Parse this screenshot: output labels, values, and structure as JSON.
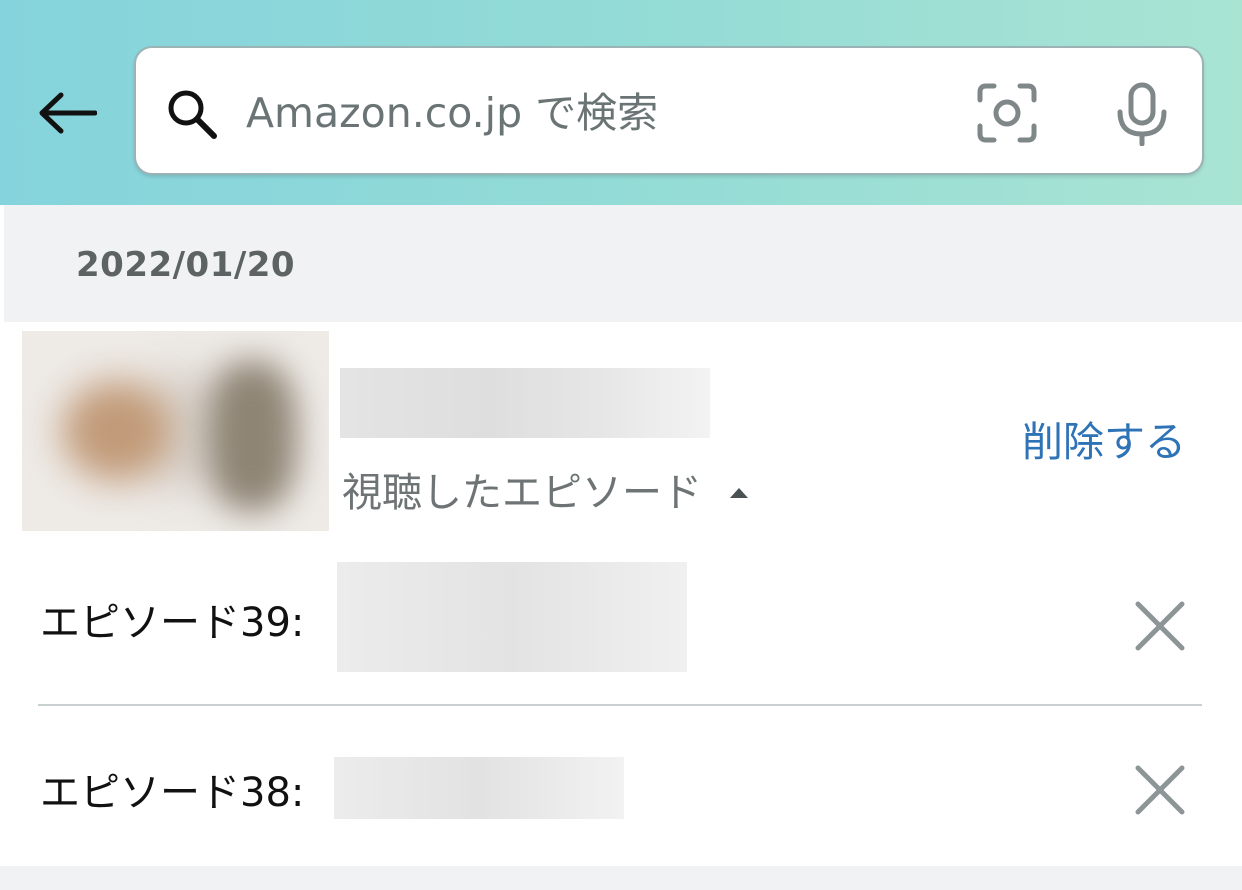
{
  "header": {
    "search": {
      "placeholder": "Amazon.co.jp で検索",
      "value": ""
    },
    "icons": [
      "back-arrow-icon",
      "search-icon",
      "camera-icon",
      "microphone-icon"
    ],
    "gradient_colors": [
      "#85d3dc",
      "#a9e4d3"
    ]
  },
  "history": {
    "date": "2022/01/20",
    "item": {
      "delete_label": "削除する",
      "watched_label": "視聴したエピソード",
      "episodes": [
        {
          "label": "エピソード39:"
        },
        {
          "label": "エピソード38:"
        }
      ]
    }
  },
  "colors": {
    "link": "#2f73b7",
    "section_bg": "#f1f2f3",
    "muted_text": "#6e7475"
  }
}
